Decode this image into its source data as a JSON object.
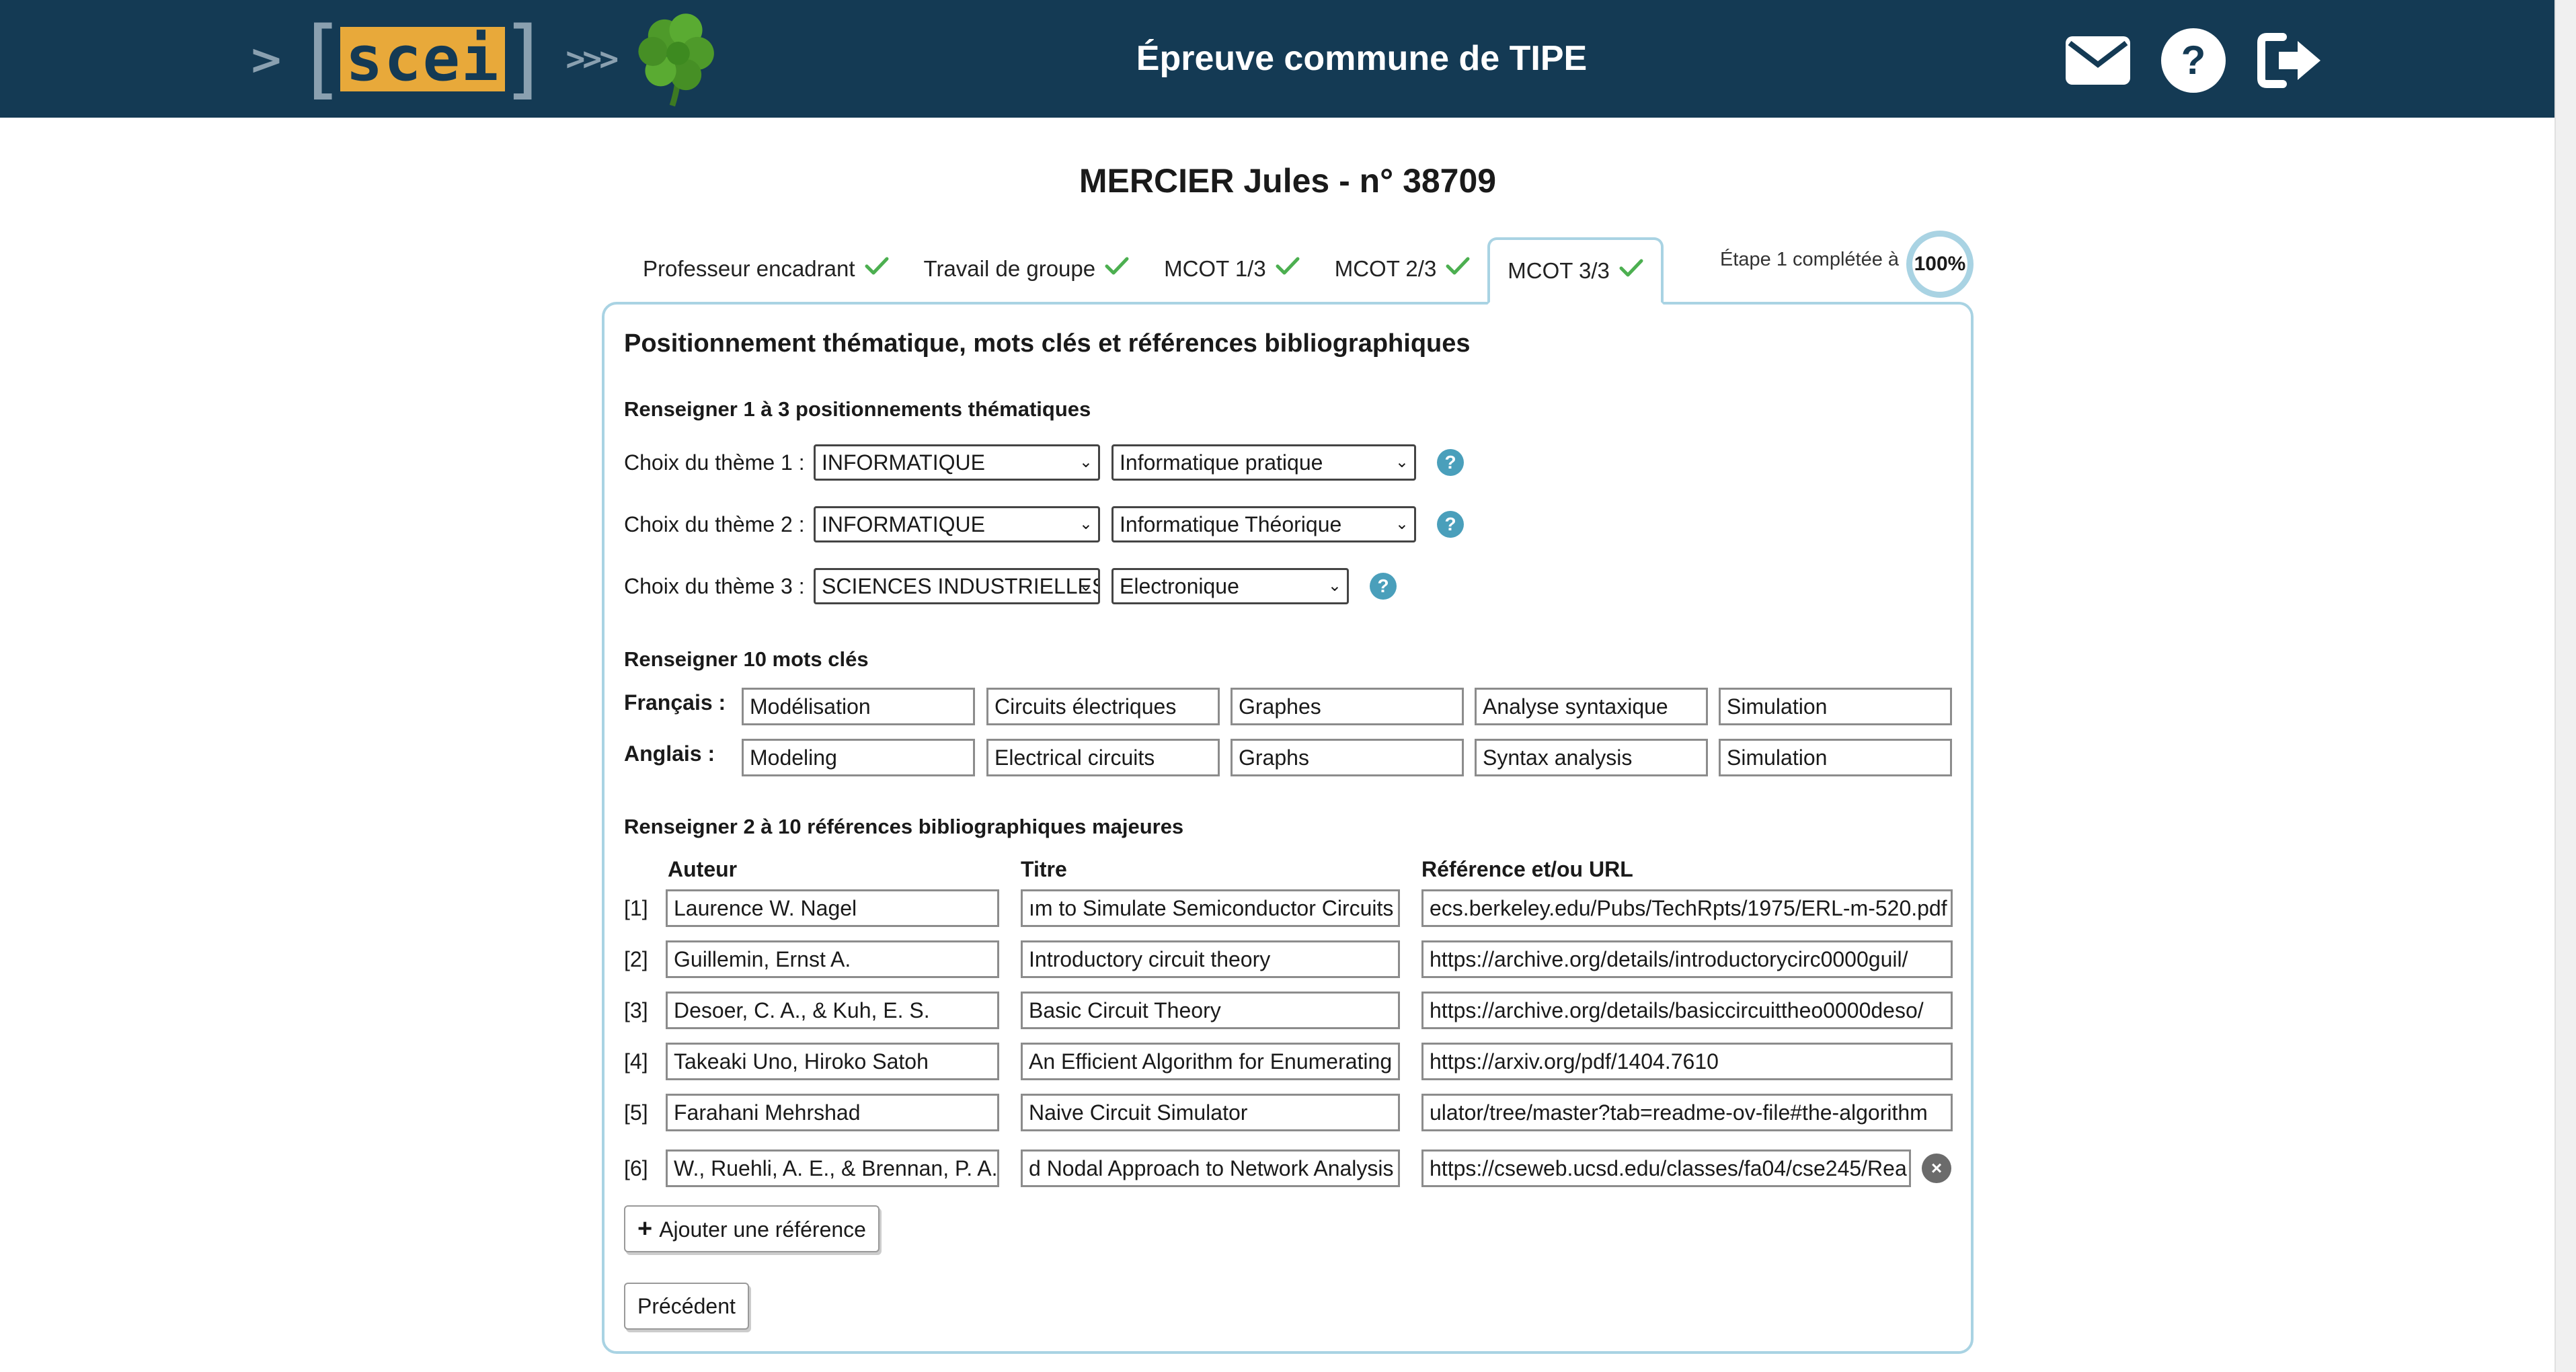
{
  "header": {
    "logo_text": "scei",
    "logo_chevron": ">",
    "logo_arrows": ">>>",
    "title": "Épreuve commune de TIPE",
    "icons": [
      "mail-icon",
      "help-icon",
      "logout-icon"
    ]
  },
  "student": {
    "name": "MERCIER Jules - n° 38709"
  },
  "tabs": [
    {
      "label": "Professeur encadrant",
      "done": true
    },
    {
      "label": "Travail de groupe",
      "done": true
    },
    {
      "label": "MCOT 1/3",
      "done": true
    },
    {
      "label": "MCOT 2/3",
      "done": true
    },
    {
      "label": "MCOT 3/3",
      "done": true,
      "active": true
    }
  ],
  "progress": {
    "label": "Étape 1 complétée à",
    "value": "100%",
    "percent": 100
  },
  "form": {
    "title": "Positionnement thématique, mots clés et références bibliographiques",
    "themes_heading": "Renseigner 1 à 3 positionnements thématiques",
    "themes": [
      {
        "label": "Choix du thème 1 :",
        "domain": "INFORMATIQUE",
        "subdomain": "Informatique pratique"
      },
      {
        "label": "Choix du thème 2 :",
        "domain": "INFORMATIQUE",
        "subdomain": "Informatique Théorique"
      },
      {
        "label": "Choix du thème 3 :",
        "domain": "SCIENCES INDUSTRIELLES",
        "subdomain": "Electronique"
      }
    ],
    "help_glyph": "?",
    "keywords_heading": "Renseigner 10 mots clés",
    "keywords": {
      "fr_label": "Français :",
      "en_label": "Anglais :",
      "fr": [
        "Modélisation",
        "Circuits électriques",
        "Graphes",
        "Analyse syntaxique",
        "Simulation"
      ],
      "en": [
        "Modeling",
        "Electrical circuits",
        "Graphs",
        "Syntax analysis",
        "Simulation"
      ]
    },
    "refs_heading": "Renseigner 2 à 10 références bibliographiques majeures",
    "refs_columns": {
      "author": "Auteur",
      "title": "Titre",
      "url": "Référence et/ou URL"
    },
    "references": [
      {
        "index": "[1]",
        "author": "Laurence W. Nagel",
        "title": "ım to Simulate Semiconductor Circuits",
        "url": "ecs.berkeley.edu/Pubs/TechRpts/1975/ERL-m-520.pdf"
      },
      {
        "index": "[2]",
        "author": "Guillemin, Ernst A.",
        "title": "Introductory circuit theory",
        "url": "https://archive.org/details/introductorycirc0000guil/"
      },
      {
        "index": "[3]",
        "author": "Desoer, C. A., & Kuh, E. S.",
        "title": "Basic Circuit Theory",
        "url": "https://archive.org/details/basiccircuittheo0000deso/"
      },
      {
        "index": "[4]",
        "author": "Takeaki Uno, Hiroko Satoh",
        "title": "An Efficient Algorithm for Enumerating",
        "url": "https://arxiv.org/pdf/1404.7610"
      },
      {
        "index": "[5]",
        "author": "Farahani Mehrshad",
        "title": "Naive Circuit Simulator",
        "url": "ulator/tree/master?tab=readme-ov-file#the-algorithm"
      },
      {
        "index": "[6]",
        "author": "W., Ruehli, A. E., & Brennan, P. A.",
        "title": "d Nodal Approach to Network Analysis",
        "url": "https://cseweb.ucsd.edu/classes/fa04/cse245/Rea"
      }
    ],
    "add_ref_label": "Ajouter une référence",
    "add_ref_glyph": "+",
    "remove_glyph": "×",
    "prev_label": "Précédent"
  },
  "colors": {
    "header_bg": "#143a54",
    "accent": "#a9d3e3",
    "check": "#4caf50",
    "help": "#4a9fbb",
    "logo": "#e8a93a"
  }
}
